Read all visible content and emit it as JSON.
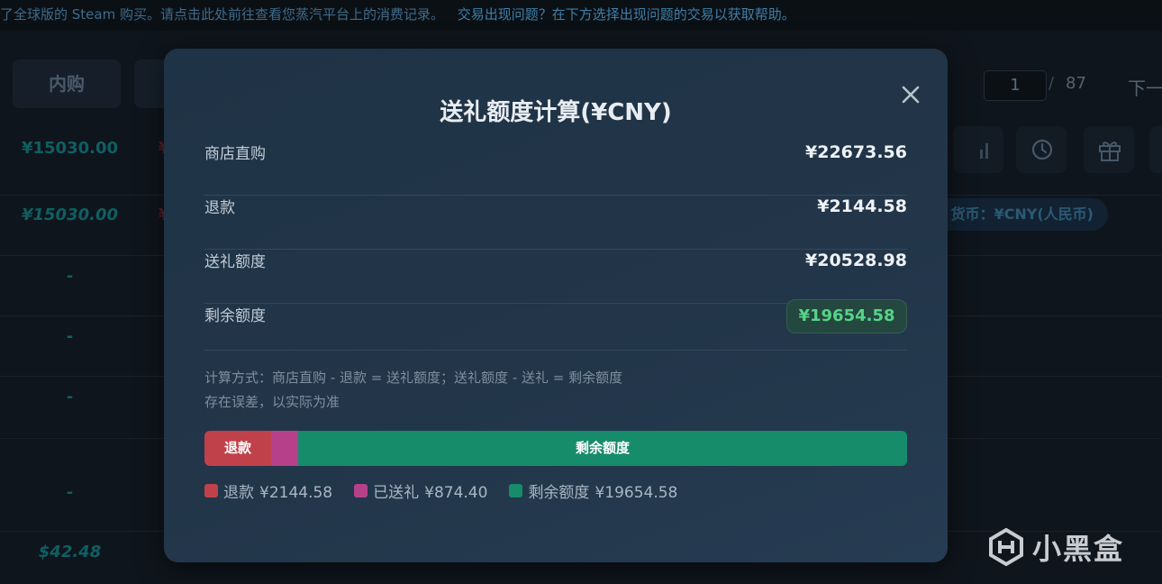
{
  "background": {
    "notice_grey": "了全球版的 Steam 购买。请点击此处前往查看您蒸汽平台上的消费记录。",
    "notice_link": "交易出现问题？在下方选择出现问题的交易以获取帮助。",
    "tab_inapp": "内购",
    "pagination": {
      "current": "1",
      "separator": "/",
      "total": "87",
      "next": "下一"
    },
    "currency_badge": "货币：¥CNY(人民币)",
    "rows": [
      {
        "amount": "¥15030.00",
        "frag": "¥"
      },
      {
        "amount": "¥15030.00",
        "frag": "¥"
      },
      {
        "amount": "-"
      },
      {
        "amount": "-"
      },
      {
        "amount": "-"
      },
      {
        "amount": "-"
      },
      {
        "amount": "$42.48"
      }
    ],
    "watermark": "小黑盒"
  },
  "modal": {
    "title": "送礼额度计算(¥CNY)",
    "rows": [
      {
        "label": "商店直购",
        "value": "¥22673.56"
      },
      {
        "label": "退款",
        "value": "¥2144.58"
      },
      {
        "label": "送礼额度",
        "value": "¥20528.98"
      },
      {
        "label": "剩余额度",
        "value": "¥19654.58"
      }
    ],
    "note_formula": "计算方式：商店直购 - 退款 = 送礼额度；送礼额度 - 送礼 = 剩余额度",
    "note_error": "存在误差，以实际为准",
    "bar": {
      "refund_label": "退款",
      "remaining_label": "剩余额度",
      "refund_amount": 2144.58,
      "gifted_amount": 874.4,
      "remaining_amount": 19654.58
    },
    "legend": [
      {
        "label": "退款",
        "amount": "¥2144.58",
        "color": "#c0414a"
      },
      {
        "label": "已送礼",
        "amount": "¥874.40",
        "color": "#b6418a"
      },
      {
        "label": "剩余额度",
        "amount": "¥19654.58",
        "color": "#168c6b"
      }
    ]
  },
  "colors": {
    "accent_green": "#56d486",
    "refund_red": "#c0414a",
    "gift_pink": "#b6418a",
    "remain_green": "#168c6b"
  }
}
